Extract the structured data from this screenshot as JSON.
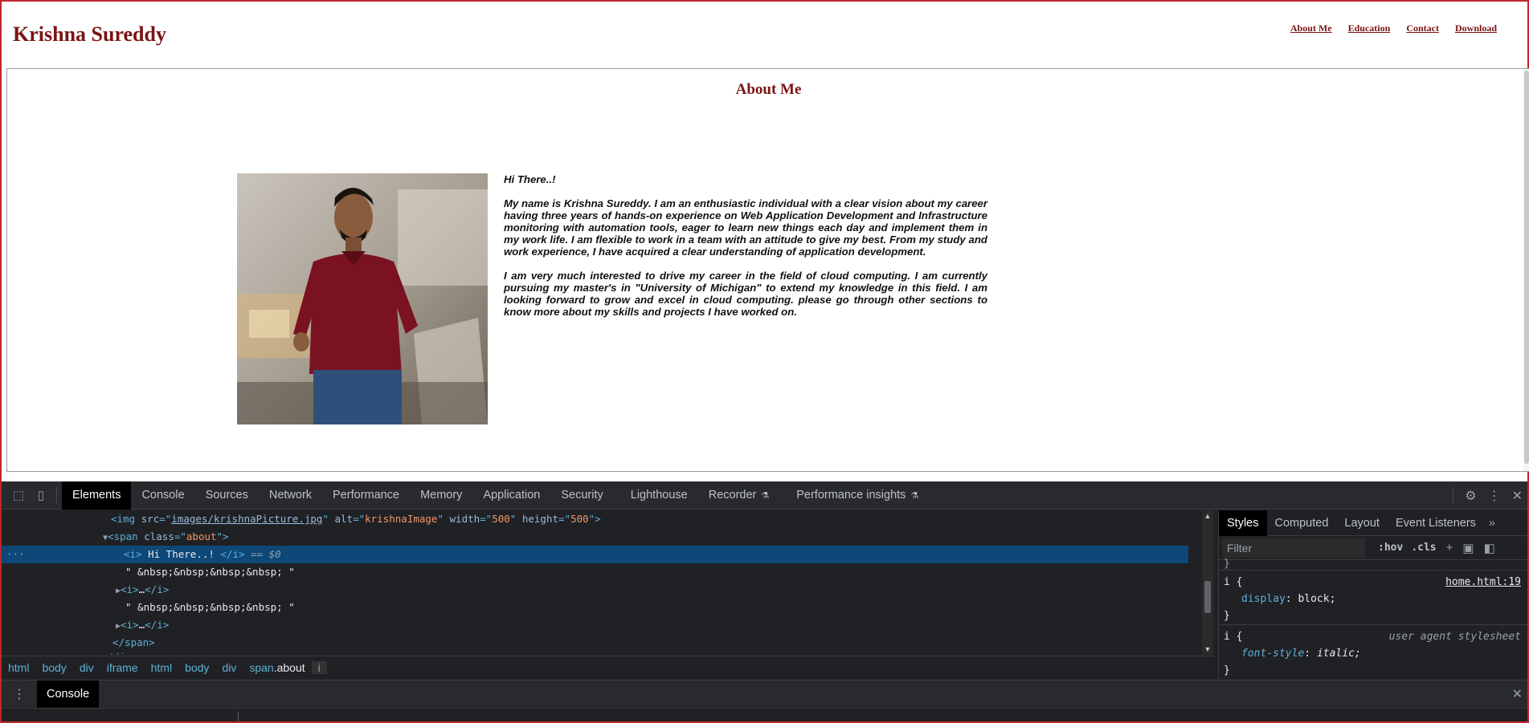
{
  "site": {
    "title": "Krishna Sureddy",
    "nav": [
      "About Me",
      "Education",
      "Contact",
      "Download"
    ]
  },
  "about": {
    "heading": "About Me",
    "greeting": "Hi There..!",
    "paragraph1": "My name is Krishna Sureddy. I am an enthusiastic individual with a clear vision about my career having three years of hands-on experience on Web Application Development and Infrastructure monitoring with automation tools, eager to learn new things each day and implement them in my work life. I am flexible to work in a team with an attitude to give my best. From my study and work experience, I have acquired a clear understanding of application development.",
    "paragraph2": "I am very much interested to drive my career in the field of cloud computing. I am currently pursuing my master's in \"University of Michigan\" to extend my knowledge in this field. I am looking forward to grow and excel in cloud computing. please go through other sections to know more about my skills and projects I have worked on."
  },
  "devtools": {
    "tabs": [
      "Elements",
      "Console",
      "Sources",
      "Network",
      "Performance",
      "Memory",
      "Application",
      "Security",
      "Lighthouse",
      "Recorder",
      "Performance insights"
    ],
    "active_tab": "Elements",
    "dom": {
      "img_src": "images/krishnaPicture.jpg",
      "img_alt": "krishnaImage",
      "img_width": "500",
      "img_height": "500",
      "span_class": "about",
      "selected_text": " Hi There..! ",
      "selected_marker": "== $0",
      "nbsp_text": "\" &nbsp;&nbsp;&nbsp;&nbsp; \"",
      "collapsed": "…"
    },
    "breadcrumbs": [
      "html",
      "body",
      "div",
      "iframe",
      "html",
      "body",
      "div",
      "span",
      "i"
    ],
    "breadcrumb_span_class": ".about",
    "styles_tabs": [
      "Styles",
      "Computed",
      "Layout",
      "Event Listeners"
    ],
    "filter_placeholder": "Filter",
    "filter_hov": ":hov",
    "filter_cls": ".cls",
    "rules": [
      {
        "selector": "i {",
        "source": "home.html:19",
        "prop": "display",
        "value": "block;"
      },
      {
        "selector": "i {",
        "source": "user agent stylesheet",
        "prop": "font-style",
        "value": "italic;"
      }
    ],
    "drawer_tab": "Console"
  }
}
